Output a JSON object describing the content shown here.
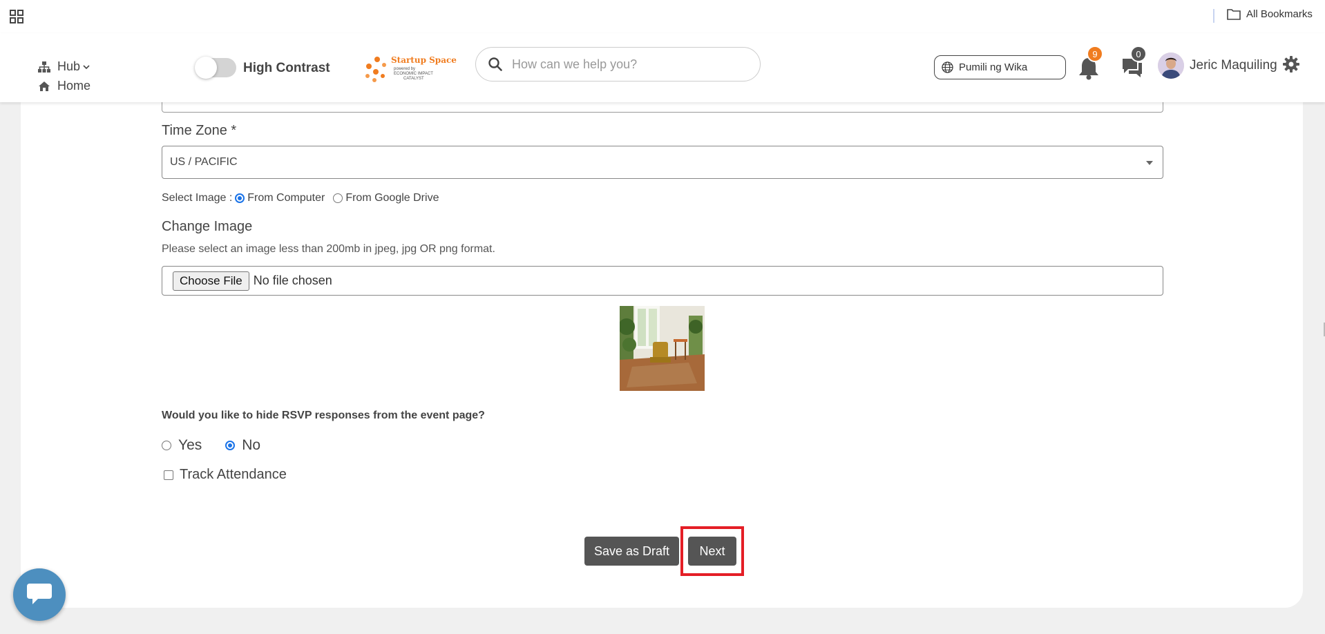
{
  "browser": {
    "bookmarks_label": "All Bookmarks"
  },
  "header": {
    "nav_hub": "Hub",
    "nav_home": "Home",
    "high_contrast_label": "High Contrast",
    "logo": {
      "line1": "Startup Space",
      "line2": "powered by",
      "line3": "ECONOMIC IMPACT",
      "line4": "CATALYST"
    },
    "search_placeholder": "How can we help you?",
    "language_label": "Pumili ng Wika",
    "notifications_count": "9",
    "messages_count": "0",
    "user_name": "Jeric Maquiling"
  },
  "form": {
    "timezone_label": "Time Zone *",
    "timezone_value": "US / PACIFIC",
    "select_image_label": "Select Image :",
    "image_source_options": [
      "From Computer",
      "From Google Drive"
    ],
    "change_image_label": "Change Image",
    "change_image_help": "Please select an image less than 200mb in jpeg, jpg OR png format.",
    "file_button_label": "Choose File",
    "file_status": "No file chosen",
    "rsvp_question": "Would you like to hide RSVP responses from the event page?",
    "rsvp_options": [
      "Yes",
      "No"
    ],
    "track_attendance_label": "Track Attendance",
    "save_draft_label": "Save as Draft",
    "next_label": "Next"
  },
  "colors": {
    "accent_orange": "#f07c1f",
    "button_dark": "#555555",
    "highlight_red": "#e41e26",
    "chat_blue": "#4d8fbf"
  }
}
